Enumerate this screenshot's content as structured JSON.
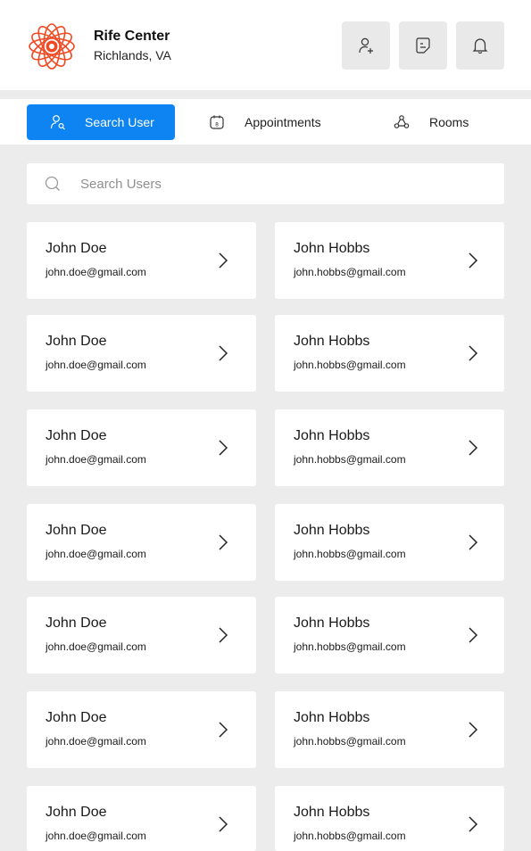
{
  "header": {
    "org_name": "Rife Center",
    "org_location": "Richlands, VA",
    "buttons": [
      {
        "name": "add-user-button",
        "icon": "user-plus-icon"
      },
      {
        "name": "notes-button",
        "icon": "note-icon"
      },
      {
        "name": "notifications-button",
        "icon": "bell-icon"
      }
    ]
  },
  "tabs": [
    {
      "label": "Search User",
      "icon": "user-search-icon",
      "active": true
    },
    {
      "label": "Appointments",
      "icon": "calendar-icon",
      "active": false
    },
    {
      "label": "Rooms",
      "icon": "rooms-icon",
      "active": false
    }
  ],
  "search": {
    "placeholder": "Search Users",
    "value": ""
  },
  "users": [
    {
      "name": "John Doe",
      "email": "john.doe@gmail.com"
    },
    {
      "name": "John Hobbs",
      "email": "john.hobbs@gmail.com"
    },
    {
      "name": "John Doe",
      "email": "john.doe@gmail.com"
    },
    {
      "name": "John Hobbs",
      "email": "john.hobbs@gmail.com"
    },
    {
      "name": "John Doe",
      "email": "john.doe@gmail.com"
    },
    {
      "name": "John Hobbs",
      "email": "john.hobbs@gmail.com"
    },
    {
      "name": "John Doe",
      "email": "john.doe@gmail.com"
    },
    {
      "name": "John Hobbs",
      "email": "john.hobbs@gmail.com"
    },
    {
      "name": "John Doe",
      "email": "john.doe@gmail.com"
    },
    {
      "name": "John Hobbs",
      "email": "john.hobbs@gmail.com"
    },
    {
      "name": "John Doe",
      "email": "john.doe@gmail.com"
    },
    {
      "name": "John Hobbs",
      "email": "john.hobbs@gmail.com"
    },
    {
      "name": "John Doe",
      "email": "john.doe@gmail.com"
    },
    {
      "name": "John Hobbs",
      "email": "john.hobbs@gmail.com"
    }
  ],
  "colors": {
    "accent": "#0d84f1",
    "logo": "#ef4a23",
    "background": "#ececec",
    "surface": "#ffffff"
  }
}
